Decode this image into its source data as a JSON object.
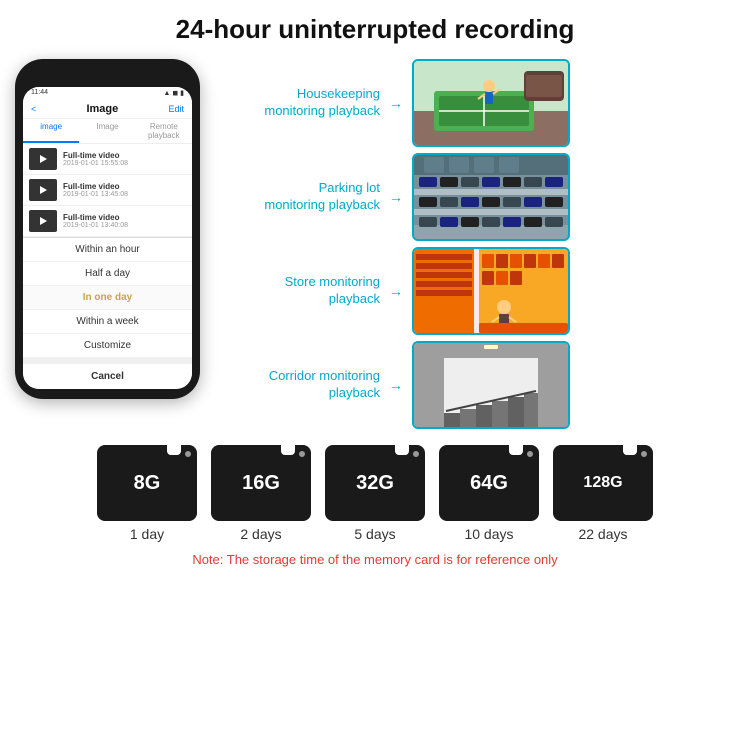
{
  "title": "24-hour uninterrupted recording",
  "phone": {
    "time": "11:44",
    "header_back": "<",
    "header_title": "Image",
    "header_edit": "Edit",
    "tabs": [
      "image",
      "Image",
      "Remote playback"
    ],
    "list_items": [
      {
        "title": "Full-time video",
        "date": "2019-01-01 15:55:08"
      },
      {
        "title": "Full-time video",
        "date": "2019-01-01 13:45:08"
      },
      {
        "title": "Full-time video",
        "date": "2019-01-01 13:40:08"
      }
    ],
    "dropdown_items": [
      "Within an hour",
      "Half a day",
      "In one day",
      "Within a week",
      "Customize"
    ],
    "cancel_label": "Cancel"
  },
  "monitoring": [
    {
      "label": "Housekeeping\nmonitoring playback",
      "photo_type": "housekeeping"
    },
    {
      "label": "Parking lot\nmonitoring playback",
      "photo_type": "parking"
    },
    {
      "label": "Store monitoring\nplayback",
      "photo_type": "store"
    },
    {
      "label": "Corridor monitoring\nplayback",
      "photo_type": "corridor"
    }
  ],
  "storage": {
    "cards": [
      {
        "size": "8G",
        "days": "1 day"
      },
      {
        "size": "16G",
        "days": "2 days"
      },
      {
        "size": "32G",
        "days": "5 days"
      },
      {
        "size": "64G",
        "days": "10 days"
      },
      {
        "size": "128G",
        "days": "22 days"
      }
    ],
    "note": "Note: The storage time of the memory card is for reference only"
  }
}
